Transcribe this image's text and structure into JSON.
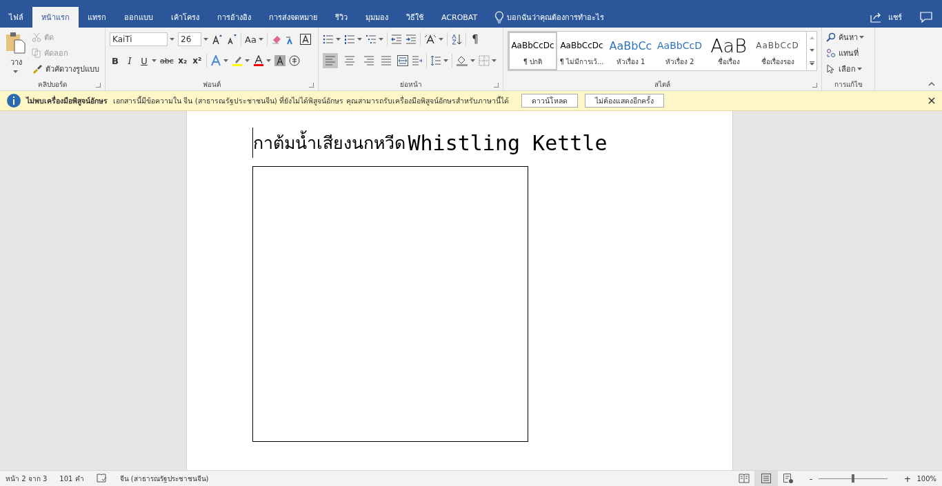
{
  "tabs": [
    {
      "label": "ไฟล์",
      "selected": false
    },
    {
      "label": "หน้าแรก",
      "selected": true
    },
    {
      "label": "แทรก",
      "selected": false
    },
    {
      "label": "ออกแบบ",
      "selected": false
    },
    {
      "label": "เค้าโครง",
      "selected": false
    },
    {
      "label": "การอ้างอิง",
      "selected": false
    },
    {
      "label": "การส่งจดหมาย",
      "selected": false
    },
    {
      "label": "รีวิว",
      "selected": false
    },
    {
      "label": "มุมมอง",
      "selected": false
    },
    {
      "label": "วิธีใช้",
      "selected": false
    },
    {
      "label": "ACROBAT",
      "selected": false
    }
  ],
  "tell_me": "บอกฉันว่าคุณต้องการทำอะไร",
  "share": "แชร์",
  "clipboard": {
    "paste": "วาง",
    "cut": "ตัด",
    "copy": "คัดลอก",
    "format_painter": "ตัวคัดวางรูปแบบ",
    "label": "คลิปบอร์ด"
  },
  "font": {
    "name": "KaiTi",
    "size": "26",
    "case": "Aa",
    "label": "ฟอนต์",
    "format_buttons": [
      {
        "kind": "bold",
        "label": "B"
      },
      {
        "kind": "italic",
        "label": "I"
      },
      {
        "kind": "underline",
        "label": "U"
      },
      {
        "kind": "strike",
        "label": "abc"
      },
      {
        "kind": "sub",
        "label": "x₂"
      },
      {
        "kind": "sup",
        "label": "x²"
      }
    ]
  },
  "paragraph": {
    "label": "ย่อหน้า",
    "alignments": [
      {
        "kind": "left",
        "selected": true
      },
      {
        "kind": "center",
        "selected": false
      },
      {
        "kind": "right",
        "selected": false
      },
      {
        "kind": "justify",
        "selected": false
      }
    ],
    "show_marks": "¶"
  },
  "styles": {
    "label": "สไตล์",
    "items": [
      {
        "kind": "normal",
        "preview": "AaBbCcDc",
        "name": "¶ ปกติ",
        "selected": true
      },
      {
        "kind": "nospace",
        "preview": "AaBbCcDc",
        "name": "¶ ไม่มีการเว้...",
        "selected": false
      },
      {
        "kind": "heading1",
        "preview": "AaBbCc",
        "name": "หัวเรื่อง 1",
        "selected": false
      },
      {
        "kind": "heading2",
        "preview": "AaBbCcD",
        "name": "หัวเรื่อง 2",
        "selected": false
      },
      {
        "kind": "title",
        "preview": "AaB",
        "name": "ชื่อเรื่อง",
        "selected": false
      },
      {
        "kind": "subtitle",
        "preview": "AaBbCcD",
        "name": "ชื่อเรื่องรอง",
        "selected": false
      }
    ]
  },
  "editing": {
    "label": "การแก้ไข",
    "find": "ค้นหา",
    "replace": "แทนที่",
    "select": "เลือก"
  },
  "message_bar": {
    "title": "ไม่พบเครื่องมือพิสูจน์อักษร",
    "text": "เอกสารนี้มีข้อความใน จีน (สาธารณรัฐประชาชนจีน) ที่ยังไม่ได้พิสูจน์อักษร คุณสามารถรับเครื่องมือพิสูจน์อักษรสำหรับภาษานี้ได้",
    "buttons": [
      "ดาวน์โหลด",
      "ไม่ต้องแสดงอีกครั้ง"
    ]
  },
  "document": {
    "heading_thai": "กาต้มน้ำเสียงนกหวีด",
    "heading_latin": "Whistling Kettle"
  },
  "status_bar": {
    "page": "หน้า 2 จาก 3",
    "words": "101 คำ",
    "language": "จีน (สาธารณรัฐประชาชนจีน)",
    "views": [
      {
        "kind": "read",
        "selected": false
      },
      {
        "kind": "print",
        "selected": true
      },
      {
        "kind": "web",
        "selected": false
      }
    ],
    "zoom_minus": "-",
    "zoom_plus": "+",
    "zoom": {
      "level": 0.5
    },
    "zoom_text": "100%"
  }
}
